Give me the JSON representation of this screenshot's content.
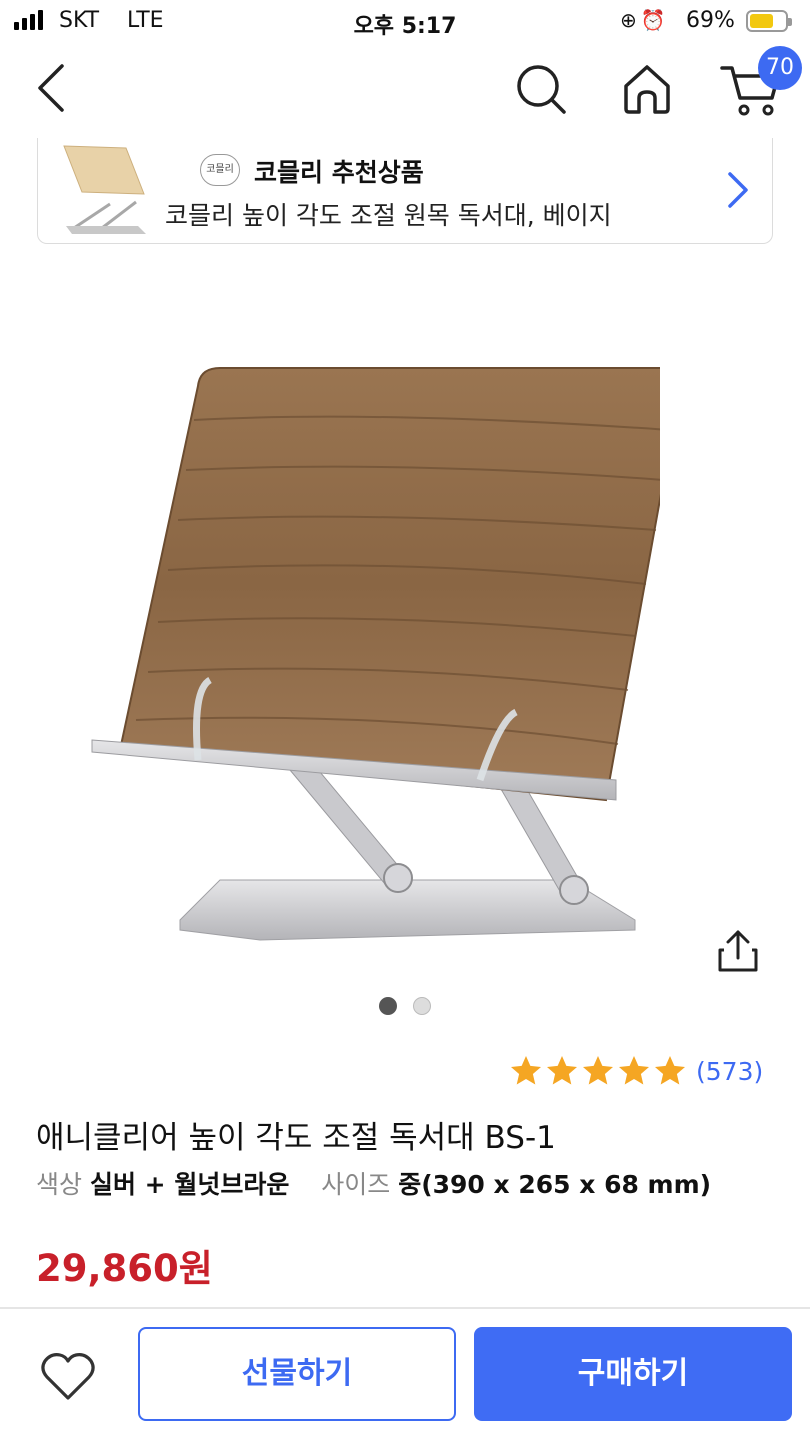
{
  "status_bar": {
    "carrier": "SKT",
    "network": "LTE",
    "time": "오후 5:17",
    "battery_percent": "69%",
    "battery_level": 0.69
  },
  "nav": {
    "cart_count": "70",
    "icons": [
      "chevron-left-icon",
      "search-icon",
      "home-icon",
      "cart-icon"
    ]
  },
  "recommendation": {
    "logo_text": "코믈리",
    "title": "코믈리 추천상품",
    "subtitle": "코믈리 높이 각도 조절 원목 독서대, 베이지"
  },
  "gallery": {
    "current_index": 1,
    "total": 2
  },
  "rating": {
    "stars": 5,
    "count": "(573)"
  },
  "product": {
    "name": "애니클리어 높이 각도 조절 독서대 BS-1",
    "color_label": "색상",
    "color_value": "실버 + 월넛브라운",
    "size_label": "사이즈",
    "size_value": "중(390 x 265 x 68 mm)",
    "price": "29,860원"
  },
  "actions": {
    "gift_label": "선물하기",
    "buy_label": "구매하기"
  },
  "colors": {
    "accent": "#3d6af2",
    "price": "#c8202a",
    "star": "#f5a623"
  }
}
